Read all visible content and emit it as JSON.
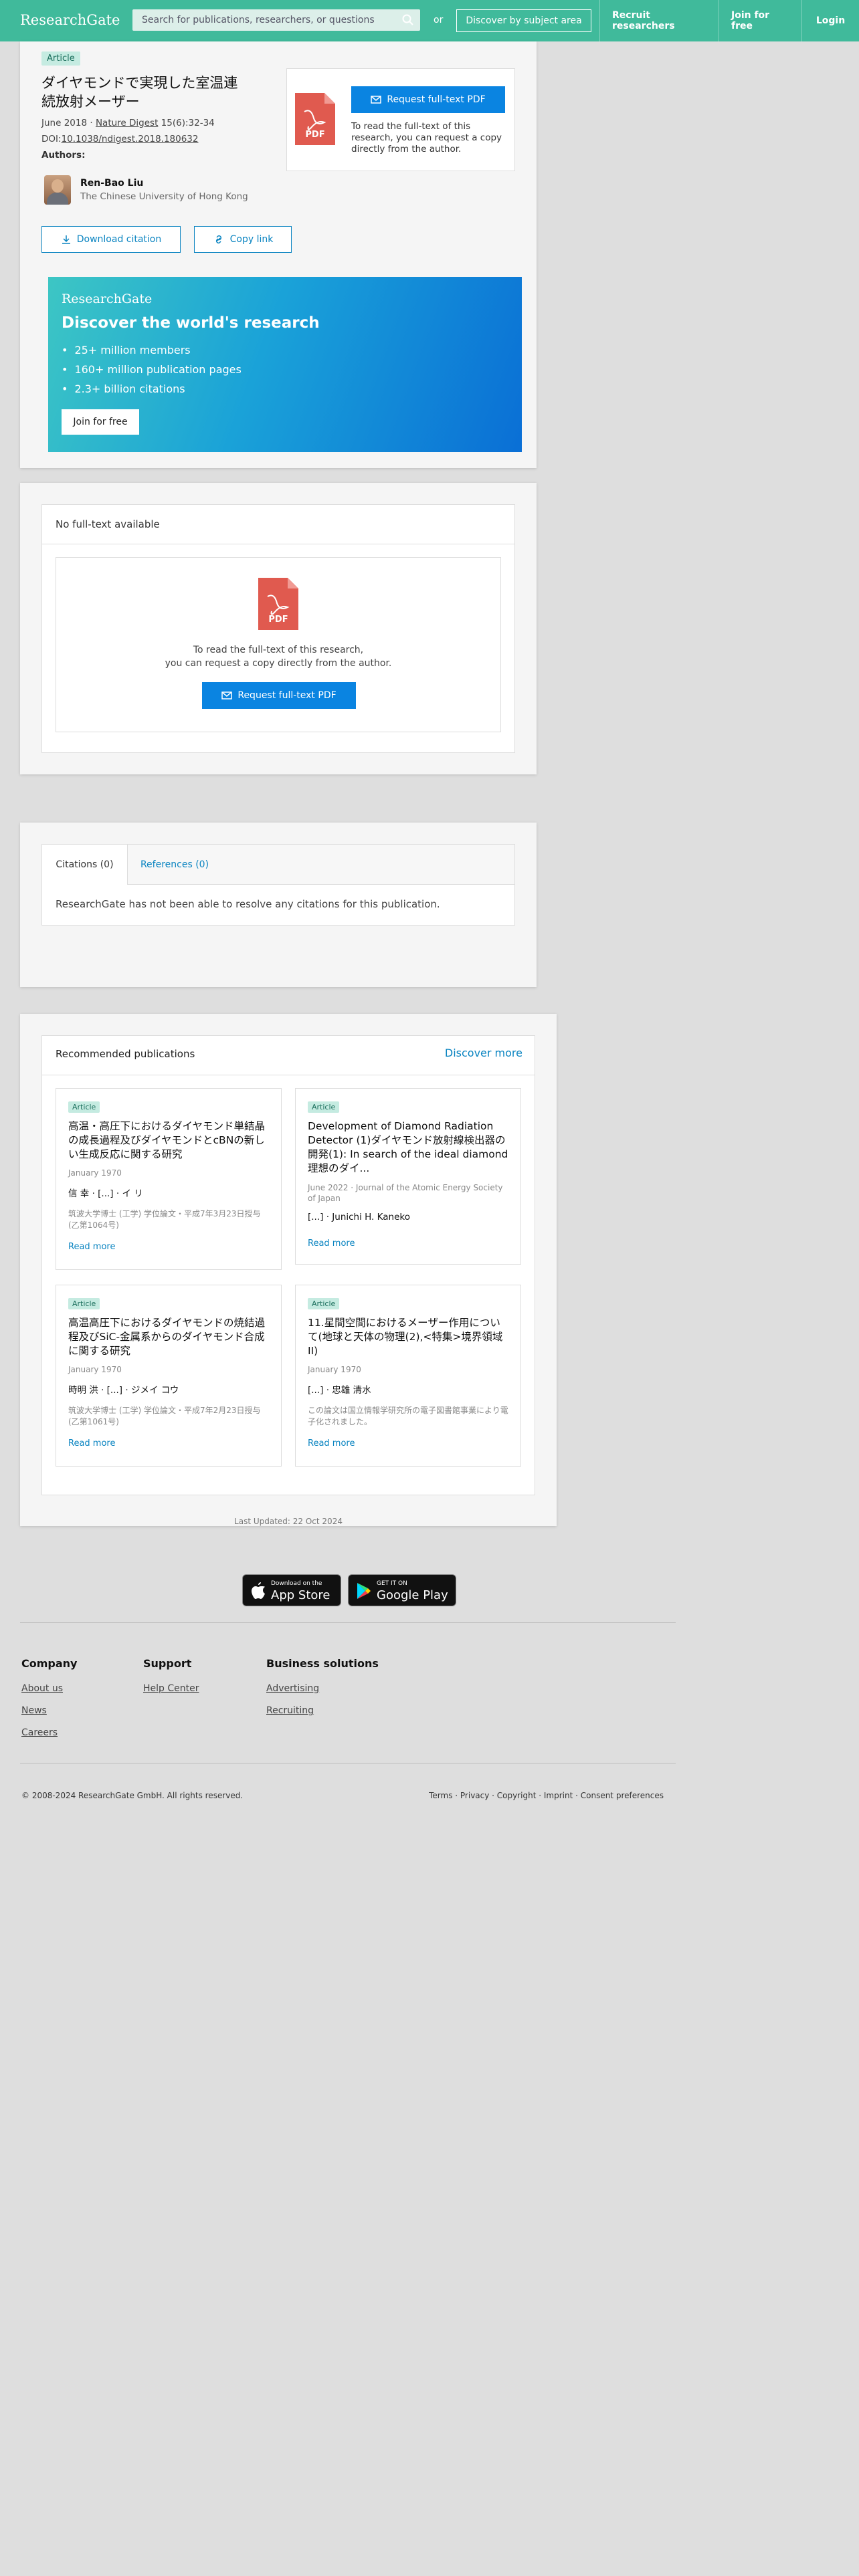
{
  "header": {
    "logo": "ResearchGate",
    "search_placeholder": "Search for publications, researchers, or questions",
    "or": "or",
    "subject_button": "Discover by subject area",
    "nav": [
      "Recruit researchers",
      "Join for free",
      "Login"
    ]
  },
  "article": {
    "tag": "Article",
    "title": "ダイヤモンドで実現した室温連続放射メーザー",
    "date": "June 2018",
    "sep": "·",
    "journal": "Nature Digest",
    "pages": "15(6):32-34",
    "doi_label": "DOI:",
    "doi": "10.1038/ndigest.2018.180632",
    "authors_label": "Authors:",
    "author_name": "Ren-Bao Liu",
    "author_affiliation": "The Chinese University of Hong Kong",
    "request_button": "Request full-text PDF",
    "request_text": "To read the full-text of this research, you can request a copy directly from the author.",
    "download_citation": "Download citation",
    "copy_link": "Copy link",
    "pdf_label": "PDF"
  },
  "promo": {
    "logo": "ResearchGate",
    "heading": "Discover the world's research",
    "bullets": [
      "25+ million members",
      "160+ million publication pages",
      "2.3+ billion citations"
    ],
    "join": "Join for free"
  },
  "fulltext": {
    "heading": "No full-text available",
    "line1": "To read the full-text of this research,",
    "line2": "you can request a copy directly from the author.",
    "button": "Request full-text PDF",
    "pdf_label": "PDF"
  },
  "citations": {
    "tab1": "Citations (0)",
    "tab2": "References (0)",
    "message": "ResearchGate has not been able to resolve any citations for this publication."
  },
  "recommended": {
    "heading": "Recommended publications",
    "discover_more": "Discover more",
    "items": [
      {
        "tag": "Article",
        "title": "高温・高圧下におけるダイヤモンド単結晶の成長過程及びダイヤモンドとcBNの新しい生成反応に関する研究",
        "date": "January 1970",
        "authors": "信 幸 · [...] · イ リ",
        "desc": "筑波大学博士 (工学) 学位論文・平成7年3月23日授与 (乙第1064号)",
        "more": "Read more"
      },
      {
        "tag": "Article",
        "title": "Development of Diamond Radiation Detector (1)ダイヤモンド放射線検出器の開発(1): In search of the ideal diamond理想のダイ...",
        "date": "June 2022 · Journal of the Atomic Energy Society of Japan",
        "authors": "[...] · Junichi H. Kaneko",
        "desc": "",
        "more": "Read more"
      },
      {
        "tag": "Article",
        "title": "高温高圧下におけるダイヤモンドの焼結過程及びSiC-金属系からのダイヤモンド合成に関する研究",
        "date": "January 1970",
        "authors": "時明 洪 · [...] · ジメイ コウ",
        "desc": "筑波大学博士 (工学) 学位論文・平成7年2月23日授与 (乙第1061号)",
        "more": "Read more"
      },
      {
        "tag": "Article",
        "title": "11.星間空間におけるメーザー作用について(地球と天体の物理(2),<特集>境界領域II)",
        "date": "January 1970",
        "authors": "[...] · 忠雄 清水",
        "desc": "この論文は国立情報学研究所の電子図書館事業により電子化されました。",
        "more": "Read more"
      }
    ]
  },
  "last_updated": "Last Updated: 22 Oct 2024",
  "apps": {
    "appstore_small": "Download on the",
    "appstore_big": "App Store",
    "googleplay_small": "GET IT ON",
    "googleplay_big": "Google Play"
  },
  "footer": {
    "company_heading": "Company",
    "company_links": [
      "About us",
      "News",
      "Careers"
    ],
    "support_heading": "Support",
    "support_links": [
      "Help Center"
    ],
    "business_heading": "Business solutions",
    "business_links": [
      "Advertising",
      "Recruiting"
    ],
    "copyright": "© 2008-2024 ResearchGate GmbH. All rights reserved.",
    "legal": "Terms · Privacy · Copyright · Imprint · Consent preferences"
  }
}
